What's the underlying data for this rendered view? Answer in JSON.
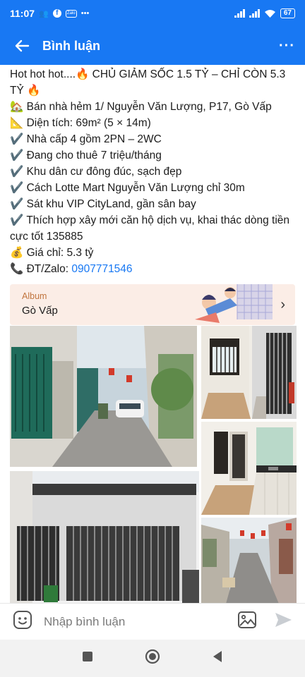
{
  "status_bar": {
    "time": "11:07",
    "battery": "67"
  },
  "header": {
    "title": "Bình luận"
  },
  "post": {
    "lines": [
      "Hot hot hot....🔥 CHỦ GIẢM SỐC 1.5 TỶ – CHỈ CÒN 5.3 TỶ 🔥",
      "🏡 Bán nhà hẻm 1/ Nguyễn Văn Lượng, P17, Gò Vấp",
      "📐 Diện tích: 69m² (5 × 14m)",
      "✔️ Nhà cấp 4 gồm 2PN – 2WC",
      "✔️ Đang cho thuê 7 triệu/tháng",
      "✔️ Khu dân cư đông đúc, sạch đẹp",
      "✔️ Cách Lotte Mart Nguyễn Văn Lượng chỉ 30m",
      "✔️ Sát khu VIP CityLand, gần sân bay",
      "✔️ Thích hợp xây mới căn hộ dịch vụ, khai thác dòng tiền cực tốt 135885",
      "💰 Giá chỉ: 5.3 tỷ"
    ],
    "contact_label": "📞 ĐT/Zalo: ",
    "phone": "0907771546"
  },
  "album": {
    "label": "Album",
    "name": "Gò Vấp"
  },
  "comment_input": {
    "placeholder": "Nhập bình luận"
  },
  "colors": {
    "brand": "#1878f3",
    "album_bg": "#fbede6"
  },
  "icons": [
    "back-arrow-icon",
    "more-icon",
    "emoji-icon",
    "image-icon",
    "send-icon",
    "recents-icon",
    "home-icon",
    "back-icon"
  ]
}
